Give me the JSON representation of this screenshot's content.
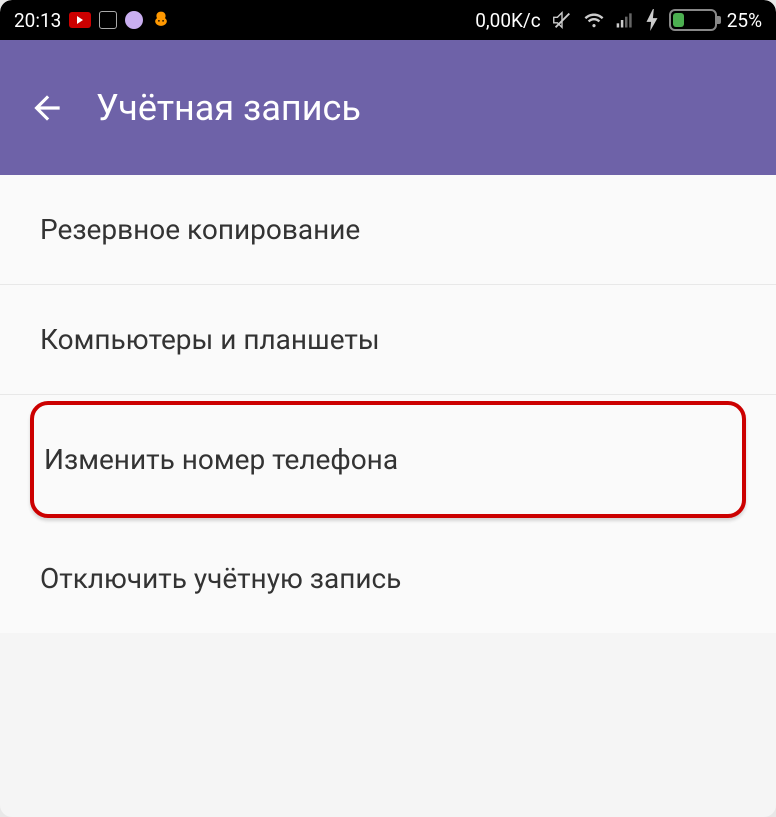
{
  "statusBar": {
    "time": "20:13",
    "dataSpeed": "0,00K/c",
    "batteryPercent": "25%"
  },
  "appBar": {
    "title": "Учётная запись"
  },
  "settings": {
    "items": [
      {
        "label": "Резервное копирование",
        "name": "backup"
      },
      {
        "label": "Компьютеры и планшеты",
        "name": "computers-tablets"
      },
      {
        "label": "Изменить номер телефона",
        "name": "change-phone-number",
        "highlighted": true
      },
      {
        "label": "Отключить учётную запись",
        "name": "deactivate-account"
      }
    ]
  }
}
